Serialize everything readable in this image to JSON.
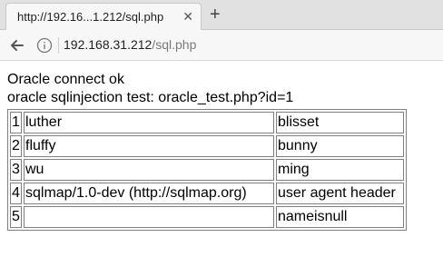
{
  "browser": {
    "tab_title": "http://192.16...1.212/sql.php",
    "close_glyph": "✕",
    "new_tab_glyph": "+",
    "url_host": "192.168.31.212",
    "url_path": "/sql.php"
  },
  "page": {
    "line1": "Oracle connect ok",
    "line2": "oracle sqlinjection test: oracle_test.php?id=1"
  },
  "table": {
    "rows": [
      [
        "1",
        "luther",
        "blisset"
      ],
      [
        "2",
        "fluffy",
        "bunny"
      ],
      [
        "3",
        "wu",
        "ming"
      ],
      [
        "4",
        "sqlmap/1.0-dev (http://sqlmap.org)",
        "user agent header"
      ],
      [
        "5",
        "",
        "nameisnull"
      ]
    ]
  },
  "colors": {
    "table_border": "#808080",
    "tab_background": "#f7f7f7",
    "tabbar_background": "#e1e1e1"
  }
}
